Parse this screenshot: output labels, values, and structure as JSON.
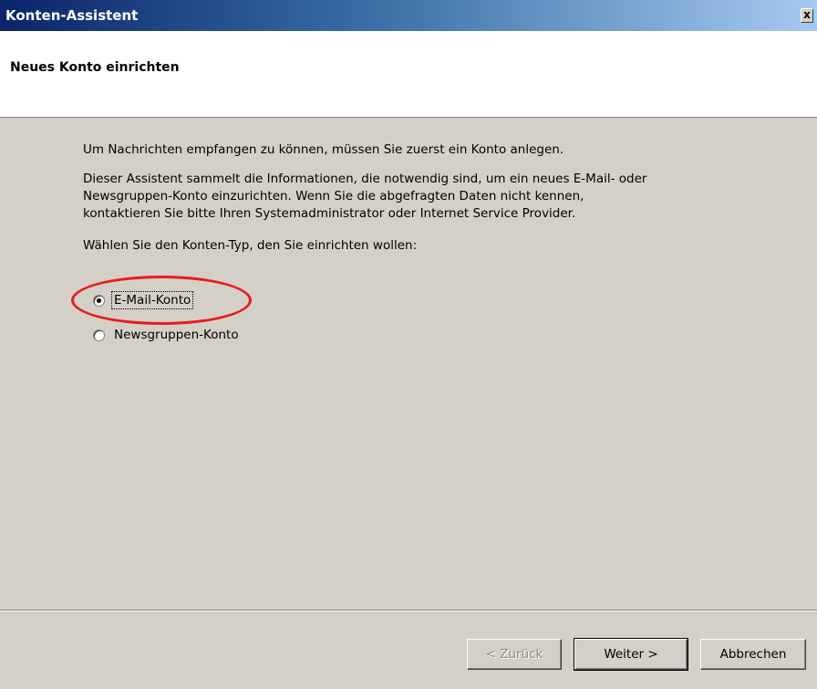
{
  "window": {
    "title": "Konten-Assistent",
    "close_label": "x"
  },
  "header": {
    "title": "Neues Konto einrichten"
  },
  "content": {
    "intro": "Um Nachrichten empfangen zu können, müssen Sie zuerst ein Konto anlegen.",
    "description_lines": [
      "Dieser Assistent sammelt die Informationen, die notwendig sind, um ein neues E-Mail- oder",
      "Newsgruppen-Konto einzurichten. Wenn Sie die abgefragten Daten nicht kennen,",
      "kontaktieren Sie bitte Ihren Systemadministrator oder Internet Service Provider."
    ],
    "prompt": "Wählen Sie den Konten-Typ, den Sie einrichten wollen:",
    "account_types": [
      {
        "label": "E-Mail-Konto",
        "selected": true
      },
      {
        "label": "Newsgruppen-Konto",
        "selected": false
      }
    ]
  },
  "buttons": {
    "back": "< Zurück",
    "next": "Weiter >",
    "cancel": "Abbrechen"
  },
  "colors": {
    "title_gradient_start": "#0a246a",
    "title_gradient_end": "#a6caf0",
    "dialog_bg": "#d4d0c8",
    "highlight_annotation": "#e81c1c"
  }
}
